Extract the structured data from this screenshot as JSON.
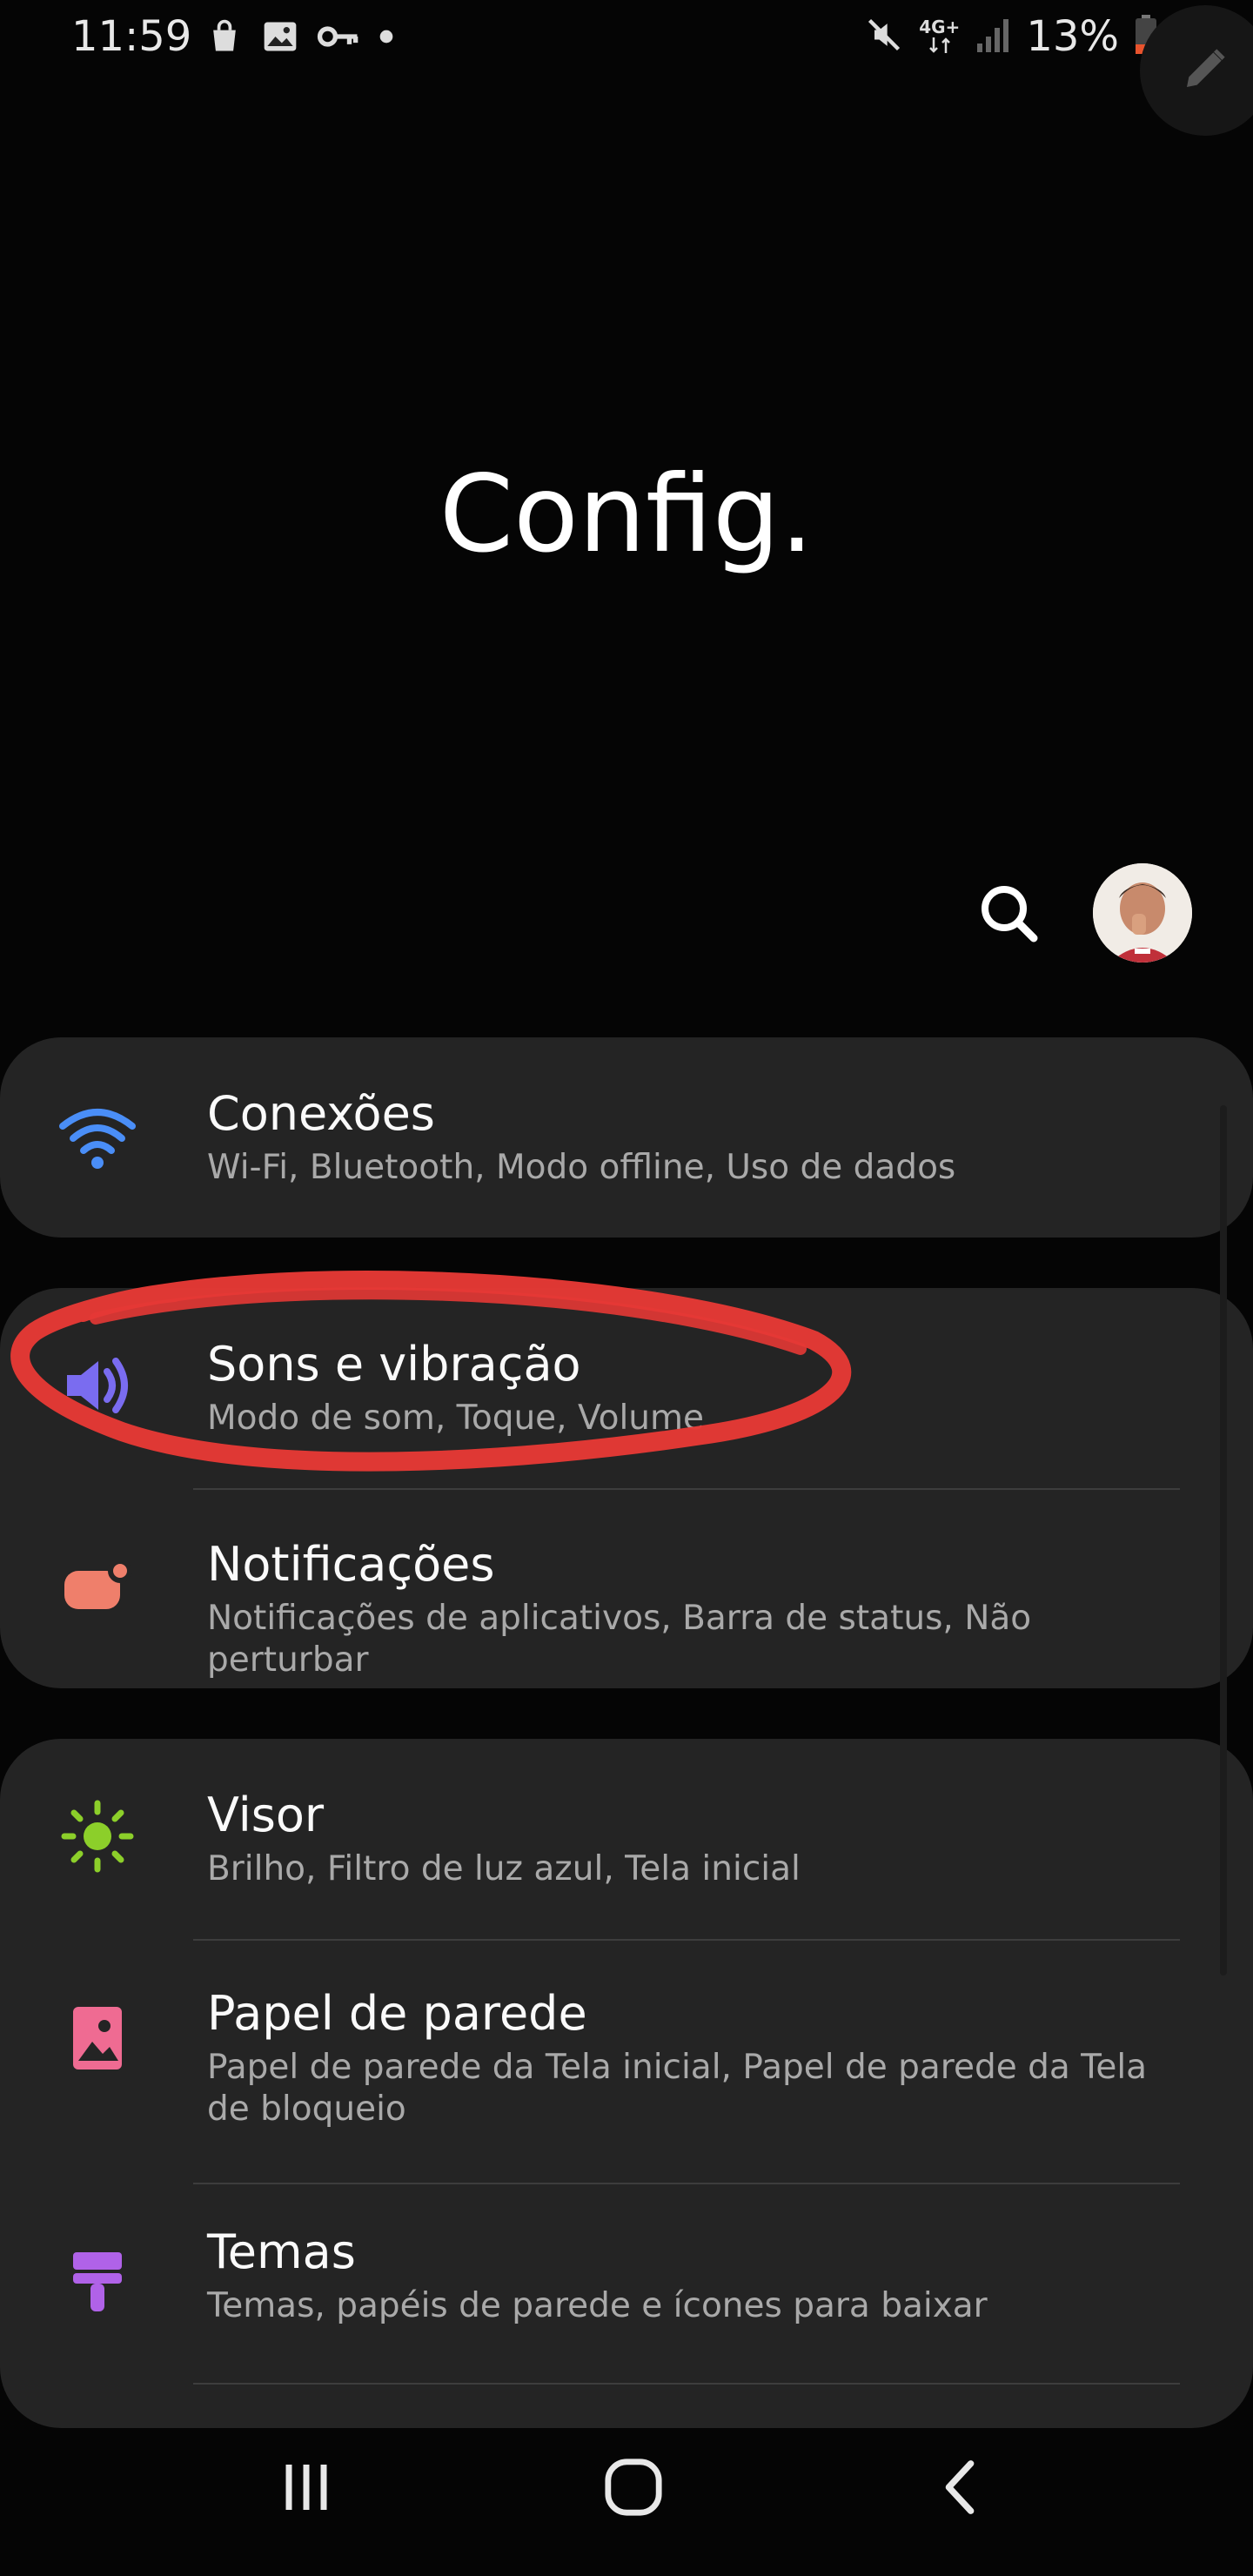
{
  "status_bar": {
    "time": "11:59",
    "network": "4G+",
    "battery": "13%",
    "left_icons": [
      "bag-icon",
      "image-icon",
      "key-icon",
      "dot-icon"
    ],
    "right_icons": [
      "mute-icon",
      "network-icon",
      "signal-icon",
      "battery-icon"
    ]
  },
  "header": {
    "title": "Config."
  },
  "sections": [
    {
      "items": [
        {
          "title": "Conexões",
          "subtitle": "Wi-Fi, Bluetooth, Modo offline, Uso de dados",
          "icon": "wifi-icon",
          "color": "#4a8ef7"
        }
      ]
    },
    {
      "items": [
        {
          "title": "Sons e vibração",
          "subtitle": "Modo de som, Toque, Volume",
          "icon": "volume-icon",
          "color": "#7a6cf0"
        },
        {
          "title": "Notificações",
          "subtitle": "Notificações de aplicativos, Barra de status, Não perturbar",
          "icon": "notification-icon",
          "color": "#ef7f6b"
        }
      ]
    },
    {
      "items": [
        {
          "title": "Visor",
          "subtitle": "Brilho, Filtro de luz azul, Tela inicial",
          "icon": "brightness-icon",
          "color": "#8ccf2a"
        },
        {
          "title": "Papel de parede",
          "subtitle": "Papel de parede da Tela inicial, Papel de parede da Tela de bloqueio",
          "icon": "wallpaper-icon",
          "color": "#ef6b92"
        },
        {
          "title": "Temas",
          "subtitle": "Temas, papéis de parede e ícones para baixar",
          "icon": "themes-icon",
          "color": "#b062e8"
        }
      ]
    }
  ],
  "annotation": {
    "color": "#e53935"
  },
  "nav_bar": {
    "items": [
      "recents-icon",
      "home-icon",
      "back-icon"
    ]
  }
}
